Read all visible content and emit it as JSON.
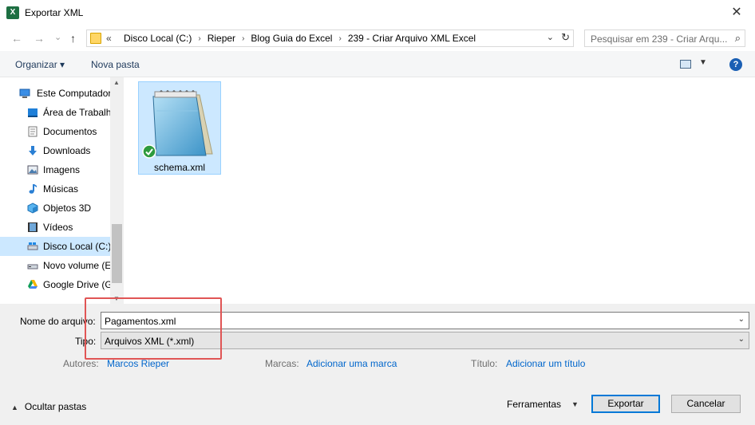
{
  "window": {
    "title": "Exportar XML",
    "app_icon_letter": "X",
    "close_glyph": "✕"
  },
  "navigation": {
    "back_glyph": "←",
    "forward_glyph": "→",
    "recent_glyph": "⌄",
    "up_glyph": "↑",
    "crumb_prefix": "«",
    "breadcrumbs": [
      "Disco Local (C:)",
      "Rieper",
      "Blog Guia do Excel",
      "239 - Criar Arquivo XML Excel"
    ],
    "search_placeholder": "Pesquisar em 239 - Criar Arqu..."
  },
  "toolbar": {
    "organize_label": "Organizar ▾",
    "new_folder_label": "Nova pasta",
    "help_glyph": "?"
  },
  "sidebar": {
    "items": [
      {
        "label": "Este Computador",
        "icon": "computer-icon"
      },
      {
        "label": "Área de Trabalho",
        "icon": "desktop-icon"
      },
      {
        "label": "Documentos",
        "icon": "documents-icon"
      },
      {
        "label": "Downloads",
        "icon": "downloads-icon"
      },
      {
        "label": "Imagens",
        "icon": "pictures-icon"
      },
      {
        "label": "Músicas",
        "icon": "music-icon"
      },
      {
        "label": "Objetos 3D",
        "icon": "3d-objects-icon"
      },
      {
        "label": "Vídeos",
        "icon": "videos-icon"
      },
      {
        "label": "Disco Local (C:)",
        "icon": "drive-icon"
      },
      {
        "label": "Novo volume (E:)",
        "icon": "drive-icon"
      },
      {
        "label": "Google Drive (G:)",
        "icon": "google-drive-icon"
      }
    ]
  },
  "files": [
    {
      "name": "schema.xml",
      "icon": "notepad-file-icon",
      "synced": true
    }
  ],
  "form": {
    "filename_label": "Nome do arquivo:",
    "filename_value": "Pagamentos.xml",
    "type_label": "Tipo:",
    "type_value": "Arquivos XML (*.xml)",
    "authors_label": "Autores:",
    "authors_value": "Marcos Rieper",
    "tags_label": "Marcas:",
    "tags_value": "Adicionar uma marca",
    "title_label": "Título:",
    "title_value": "Adicionar um título"
  },
  "footer": {
    "hide_folders_label": "Ocultar pastas",
    "tools_label": "Ferramentas",
    "export_label": "Exportar",
    "cancel_label": "Cancelar"
  },
  "colors": {
    "accent": "#0078d7",
    "selection": "#cce8ff",
    "highlight_box": "#e05555",
    "link": "#0066cc"
  }
}
